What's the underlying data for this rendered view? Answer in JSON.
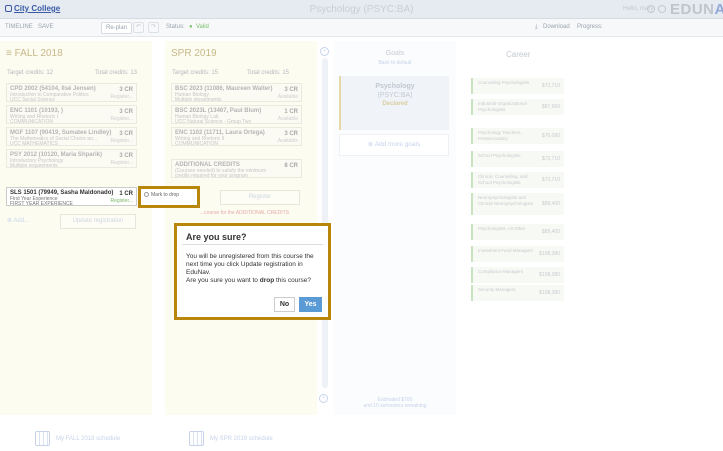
{
  "header": {
    "logo": "City College",
    "title": "Psychology (PSYC:BA)",
    "greeting": "Hello, mary",
    "brand_main": "EDUN",
    "brand_accent": "AV"
  },
  "toolbar": {
    "timeline": "TIMELINE",
    "save": "SAVE",
    "replan": "Re-plan",
    "undo_icon": "↶",
    "redo_icon": "↷",
    "status_label": "Status:",
    "status_value": "Valid",
    "download": "Download",
    "progress": "Progress:"
  },
  "fall": {
    "title": "FALL 2018",
    "target": "Target credits: 12",
    "total": "Total credits: 13",
    "courses": [
      {
        "code": "CPD 2002 (54104, Ilsé Jensen)",
        "line2": "Introduction to Comparative Politics",
        "line3": "UCC Social Science",
        "credits": "3 CR",
        "status": "Register..."
      },
      {
        "code": "ENC 1101 (10193, )",
        "line2": "Writing and Rhetoric I",
        "line3": "COMMUNICATION",
        "credits": "3 CR",
        "status": "Register..."
      },
      {
        "code": "MGF 1107 (90419, Sumatee Lindley)",
        "line2": "The Mathematics of Social Choice an...",
        "line3": "UCC MATHEMATICS",
        "credits": "3 CR",
        "status": "Register..."
      },
      {
        "code": "PSY 2012 (10120, Maria Shparik)",
        "line2": "Introductory Psychology",
        "line3": "Multiple requirements",
        "credits": "3 CR",
        "status": "Register..."
      },
      {
        "code": "SLS 1501 (79949, Sasha Maldonado)",
        "line2": "First Year Experience",
        "line3": "FIRST YEAR EXPERIENCE",
        "credits": "1 CR",
        "status": "Register..."
      }
    ],
    "add": "Add...",
    "update": "Update registration",
    "schedule": "My FALL 2018 schedule"
  },
  "spring": {
    "title": "SPR 2019",
    "target": "Target credits: 15",
    "total": "Total credits: 15",
    "courses": [
      {
        "code": "BSC 2023 (11086, Maureen Walter)",
        "line2": "Human Biology",
        "line3": "Multiple departments",
        "credits": "3 CR",
        "status": "Available"
      },
      {
        "code": "BSC 2023L (13467, Paul Blum)",
        "line2": "Human Biology Lab",
        "line3": "UCC Natural Science - Group Two",
        "credits": "1 CR",
        "status": "Available"
      },
      {
        "code": "ENC 1102 (11711, Laura Ortega)",
        "line2": "Writing and Rhetoric II",
        "line3": "COMMUNICATION",
        "credits": "3 CR",
        "status": "Available"
      },
      {
        "code": "ADDITIONAL CREDITS",
        "line2": "(Courses needed) to satisfy the minimum",
        "line3": "credits required for your program",
        "credits": "8 CR",
        "status": ""
      }
    ],
    "register": "Register",
    "note": "...course for the ADDITIONAL CREDITS",
    "schedule": "My SPR 2019 schedule"
  },
  "drop": {
    "label": "Mark to drop"
  },
  "dialog": {
    "title": "Are you sure?",
    "line1": "You will be unregistered from this course the",
    "line2": "next time you click Update registration in",
    "line3": "EduNav.",
    "line4_pre": "Are you sure you want to ",
    "line4_bold": "drop",
    "line4_post": " this course?",
    "no": "No",
    "yes": "Yes"
  },
  "goals": {
    "title": "Goals",
    "back": "Back to default",
    "goal_name": "Psychology",
    "goal_code": "(PSYC:BA)",
    "goal_status": "Declared",
    "add_more": "Add more goals",
    "footer1": "Estimated $700",
    "footer2": "and 10 semesters remaining"
  },
  "career": {
    "title": "Career",
    "items": [
      {
        "name": "Counseling Psychologists",
        "salary": "$72,710"
      },
      {
        "name": "Industrial-Organizational Psychologists",
        "salary": "$87,960"
      },
      {
        "name": "Psychology Teachers, Postsecondary",
        "salary": "$76,090"
      },
      {
        "name": "School Psychologists",
        "salary": "$72,710"
      },
      {
        "name": "Clinical, Counseling, and School Psychologists",
        "salary": "$72,710"
      },
      {
        "name": "Neuropsychologists and Clinical Neuropsychologists",
        "salary": "$89,400"
      },
      {
        "name": "Psychologists, All Other",
        "salary": "$89,400"
      },
      {
        "name": "Investment Fund Managers",
        "salary": "$108,380"
      },
      {
        "name": "Compliance Managers",
        "salary": "$108,380"
      },
      {
        "name": "Security Managers",
        "salary": "$108,380"
      }
    ]
  },
  "colors": {
    "accent": "#5b9bd5",
    "highlight_border": "#b8860b",
    "valid": "#7dbf6b"
  }
}
